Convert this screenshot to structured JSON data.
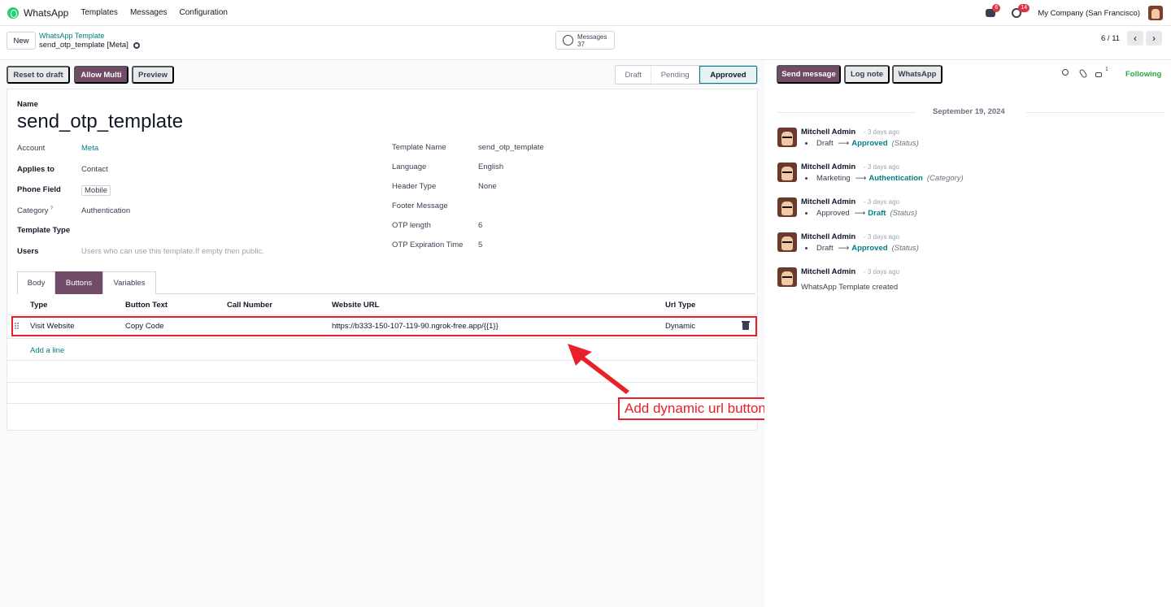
{
  "app": {
    "name": "WhatsApp"
  },
  "nav": {
    "menu": [
      "Templates",
      "Messages",
      "Configuration"
    ],
    "company": "My Company (San Francisco)"
  },
  "systray": {
    "messages_badge": "6",
    "activity_badge": "14"
  },
  "control": {
    "new_label": "New",
    "breadcrumb_parent": "WhatsApp Template",
    "breadcrumb_current": "send_otp_template [Meta]",
    "stat_label": "Messages",
    "stat_value": "37",
    "pager": "6 / 11"
  },
  "statusbar": {
    "reset_label": "Reset to draft",
    "allow_multi_label": "Allow Multi",
    "preview_label": "Preview",
    "stages": [
      "Draft",
      "Pending",
      "Approved"
    ],
    "active_stage": "Approved"
  },
  "form": {
    "name_label": "Name",
    "name_value": "send_otp_template",
    "left_fields": [
      {
        "label": "Account",
        "value": "Meta"
      },
      {
        "label": "Applies to",
        "value": "Contact"
      },
      {
        "label": "Phone Field",
        "value": "Mobile"
      },
      {
        "label": "Category",
        "value": "Authentication",
        "help": "?"
      },
      {
        "label": "Template Type",
        "value": ""
      },
      {
        "label": "Users",
        "value": "Users who can use this template.If empty then public."
      }
    ],
    "right_fields": [
      {
        "label": "Template Name",
        "value": "send_otp_template"
      },
      {
        "label": "Language",
        "value": "English"
      },
      {
        "label": "Header Type",
        "value": "None"
      },
      {
        "label": "Footer Message",
        "value": ""
      },
      {
        "label": "OTP length",
        "value": "6"
      },
      {
        "label": "OTP Expiration Time",
        "value": "5"
      }
    ],
    "tabs": [
      "Body",
      "Buttons",
      "Variables"
    ],
    "active_tab": "Buttons",
    "table": {
      "columns": [
        "Type",
        "Button Text",
        "Call Number",
        "Website URL",
        "Url Type"
      ],
      "rows": [
        {
          "type": "Visit Website",
          "button_text": "Copy Code",
          "call_number": "",
          "website_url": "https://b333-150-107-119-90.ngrok-free.app/{{1}}",
          "url_type": "Dynamic"
        }
      ],
      "add_line": "Add a line"
    }
  },
  "annotation": {
    "text": "Add dynamic url button for copy OTP code",
    "color": "#e8202a"
  },
  "chatter": {
    "send_message": "Send message",
    "log_note": "Log note",
    "whatsapp": "WhatsApp",
    "follower_count": "1",
    "following": "Following",
    "date": "September 19, 2024",
    "messages": [
      {
        "author": "Mitchell Admin",
        "ago": "- 3 days ago",
        "old": "Draft",
        "new": "Approved",
        "field": "(Status)"
      },
      {
        "author": "Mitchell Admin",
        "ago": "- 3 days ago",
        "old": "Marketing",
        "new": "Authentication",
        "field": "(Category)"
      },
      {
        "author": "Mitchell Admin",
        "ago": "- 3 days ago",
        "old": "Approved",
        "new": "Draft",
        "field": "(Status)"
      },
      {
        "author": "Mitchell Admin",
        "ago": "- 3 days ago",
        "old": "Draft",
        "new": "Approved",
        "field": "(Status)"
      },
      {
        "author": "Mitchell Admin",
        "ago": "- 3 days ago",
        "body": "WhatsApp Template created"
      }
    ]
  },
  "colors": {
    "primary": "#714b67",
    "link": "#017e84",
    "following": "#28a745",
    "badge": "#dc3545"
  }
}
